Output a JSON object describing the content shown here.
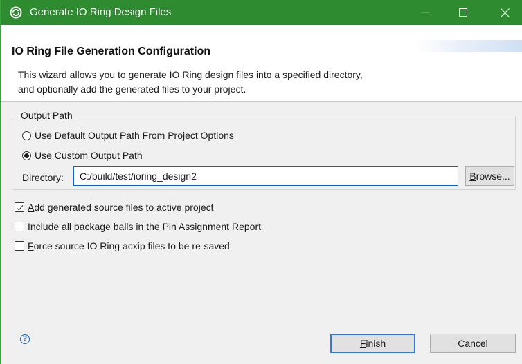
{
  "window": {
    "title": "Generate IO Ring Design Files",
    "titlebar_color": "#2e8b2f"
  },
  "header": {
    "title": "IO Ring File Generation Configuration",
    "description_line1": "This wizard allows you to generate IO Ring design files into a specified directory,",
    "description_line2": "and optionally add the generated files to your project."
  },
  "output_path": {
    "group_label": "Output Path",
    "option_default": {
      "pre": "Use Default Output Path From ",
      "mnemonic": "P",
      "post": "roject Options",
      "selected": false
    },
    "option_custom": {
      "pre": "",
      "mnemonic": "U",
      "post": "se Custom Output Path",
      "selected": true
    },
    "directory_label_mnemonic": "D",
    "directory_label_rest": "irectory:",
    "directory_value": "C:/build/test/ioring_design2",
    "browse": {
      "mnemonic": "B",
      "rest": "rowse..."
    }
  },
  "checkboxes": [
    {
      "pre": "",
      "mnemonic": "A",
      "post": "dd generated source files to active project",
      "checked": true
    },
    {
      "pre": "Include all package balls in the Pin Assignment ",
      "mnemonic": "R",
      "post": "eport",
      "checked": false
    },
    {
      "pre": "",
      "mnemonic": "F",
      "post": "orce source IO Ring acxip files to be re-saved",
      "checked": false
    }
  ],
  "footer": {
    "help_icon": "?",
    "finish": {
      "mnemonic": "F",
      "rest": "inish"
    },
    "cancel": "Cancel"
  },
  "icons": {
    "app": "app-logo-icon",
    "minimize": "minimize-icon",
    "maximize": "maximize-icon",
    "close": "close-icon",
    "help": "help-icon"
  }
}
